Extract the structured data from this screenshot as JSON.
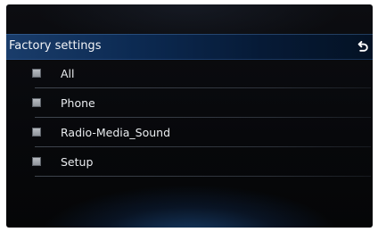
{
  "header": {
    "title": "Factory settings",
    "back_icon": "back-arrow-icon"
  },
  "list": {
    "items": [
      {
        "label": "All",
        "checked": false
      },
      {
        "label": "Phone",
        "checked": false
      },
      {
        "label": "Radio-Media_Sound",
        "checked": false
      },
      {
        "label": "Setup",
        "checked": false
      }
    ]
  },
  "colors": {
    "header_gradient_start": "#1a3d6b",
    "header_gradient_end": "#041224",
    "background": "#07080b",
    "text": "#f2f4f7",
    "checkbox": "#9ea3a9"
  }
}
